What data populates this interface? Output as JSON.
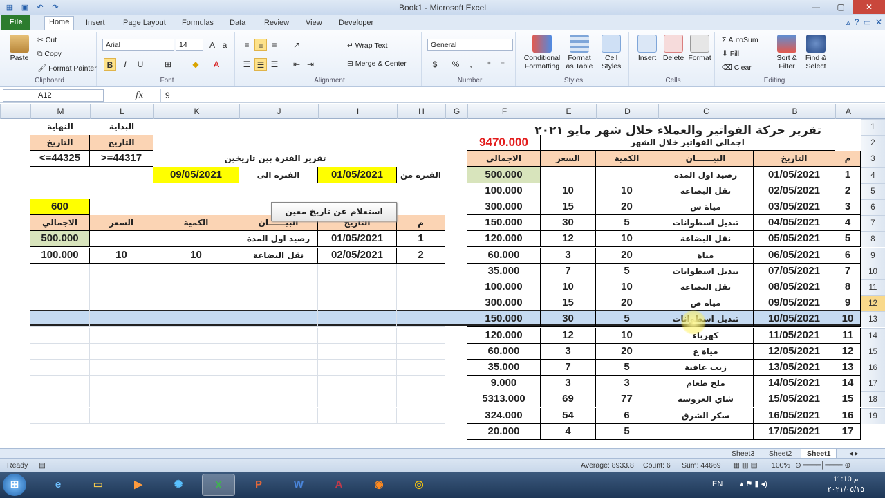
{
  "window": {
    "title": "Book1 - Microsoft Excel"
  },
  "tabs": [
    "File",
    "Home",
    "Insert",
    "Page Layout",
    "Formulas",
    "Data",
    "Review",
    "View",
    "Developer"
  ],
  "ribbon": {
    "clipboard": {
      "paste": "Paste",
      "cut": "Cut",
      "copy": "Copy",
      "format_painter": "Format Painter",
      "group": "Clipboard"
    },
    "font": {
      "family": "Arial",
      "size": "14",
      "bold": "B",
      "italic": "I",
      "underline": "U",
      "group": "Font"
    },
    "alignment": {
      "wrap": "Wrap Text",
      "merge": "Merge & Center",
      "group": "Alignment"
    },
    "number": {
      "format": "General",
      "percent": "%",
      "comma": ",",
      "group": "Number"
    },
    "styles": {
      "conditional": "Conditional Formatting",
      "format_table": "Format as Table",
      "cell_styles": "Cell Styles",
      "group": "Styles"
    },
    "cells": {
      "insert": "Insert",
      "delete": "Delete",
      "format": "Format",
      "group": "Cells"
    },
    "editing": {
      "autosum": "AutoSum",
      "fill": "Fill",
      "clear": "Clear",
      "sort": "Sort & Filter",
      "find": "Find & Select",
      "group": "Editing"
    }
  },
  "formula_bar": {
    "name_box": "A12",
    "fx": "fx",
    "value": "9"
  },
  "columns": [
    "M",
    "L",
    "K",
    "J",
    "I",
    "H",
    "G",
    "F",
    "E",
    "D",
    "C",
    "B",
    "A"
  ],
  "rows": [
    "1",
    "2",
    "3",
    "4",
    "5",
    "6",
    "7",
    "8",
    "9",
    "10",
    "11",
    "12",
    "13",
    "14",
    "15",
    "16",
    "17",
    "18",
    "19"
  ],
  "sheet": {
    "title": "تقرير حركة الفواتير والعملاء خلال شهر مايو ٢٠٢١",
    "total_label": "اجمالي الفواتير خلال الشهر",
    "total_value": "9470.000",
    "headers": {
      "no": "م",
      "date": "التاريخ",
      "desc": "البيــــــان",
      "qty": "الكمية",
      "price": "السعر",
      "total": "الاجمالي"
    },
    "rows": [
      {
        "no": "1",
        "date": "01/05/2021",
        "desc": "رصيد اول المدة",
        "qty": "",
        "price": "",
        "total": "500.000"
      },
      {
        "no": "2",
        "date": "02/05/2021",
        "desc": "نقل البضاعة",
        "qty": "10",
        "price": "10",
        "total": "100.000"
      },
      {
        "no": "3",
        "date": "03/05/2021",
        "desc": "مياة س",
        "qty": "20",
        "price": "15",
        "total": "300.000"
      },
      {
        "no": "4",
        "date": "04/05/2021",
        "desc": "تبديل اسطوانات",
        "qty": "5",
        "price": "30",
        "total": "150.000"
      },
      {
        "no": "5",
        "date": "05/05/2021",
        "desc": "نقل البضاعة",
        "qty": "10",
        "price": "12",
        "total": "120.000"
      },
      {
        "no": "6",
        "date": "06/05/2021",
        "desc": "مياة",
        "qty": "20",
        "price": "3",
        "total": "60.000"
      },
      {
        "no": "7",
        "date": "07/05/2021",
        "desc": "تبديل اسطوانات",
        "qty": "5",
        "price": "7",
        "total": "35.000"
      },
      {
        "no": "8",
        "date": "08/05/2021",
        "desc": "نقل البضاعة",
        "qty": "10",
        "price": "10",
        "total": "100.000"
      },
      {
        "no": "9",
        "date": "09/05/2021",
        "desc": "مياة ص",
        "qty": "20",
        "price": "15",
        "total": "300.000"
      },
      {
        "no": "10",
        "date": "10/05/2021",
        "desc": "تبديل اسطوانات",
        "qty": "5",
        "price": "30",
        "total": "150.000"
      },
      {
        "no": "11",
        "date": "11/05/2021",
        "desc": "كهرباء",
        "qty": "10",
        "price": "12",
        "total": "120.000"
      },
      {
        "no": "12",
        "date": "12/05/2021",
        "desc": "مياة ع",
        "qty": "20",
        "price": "3",
        "total": "60.000"
      },
      {
        "no": "13",
        "date": "13/05/2021",
        "desc": "زيت عافية",
        "qty": "5",
        "price": "7",
        "total": "35.000"
      },
      {
        "no": "14",
        "date": "14/05/2021",
        "desc": "ملح طعام",
        "qty": "3",
        "price": "3",
        "total": "9.000"
      },
      {
        "no": "15",
        "date": "15/05/2021",
        "desc": "شاي العروسة",
        "qty": "77",
        "price": "69",
        "total": "5313.000"
      },
      {
        "no": "16",
        "date": "16/05/2021",
        "desc": "سكر الشرق",
        "qty": "6",
        "price": "54",
        "total": "324.000"
      },
      {
        "no": "17",
        "date": "17/05/2021",
        "desc": "",
        "qty": "5",
        "price": "4",
        "total": "20.000"
      }
    ],
    "report": {
      "start_label": "البداية",
      "end_label": "النهاية",
      "date_hdr": "التاريخ",
      "crit_start": ">=44317",
      "crit_end": "<=44325",
      "heading": "تقرير الفترة بين تاريخين",
      "from_label": "الفترة من",
      "from_value": "01/05/2021",
      "to_label": "الفترة الى",
      "to_value": "09/05/2021",
      "button": "استعلام عن تاريخ معين",
      "sum": "600",
      "rows": [
        {
          "no": "1",
          "date": "01/05/2021",
          "desc": "رصيد اول المدة",
          "qty": "",
          "price": "",
          "total": "500.000"
        },
        {
          "no": "2",
          "date": "02/05/2021",
          "desc": "نقل البضاعة",
          "qty": "10",
          "price": "10",
          "total": "100.000"
        }
      ]
    }
  },
  "sheet_tabs": [
    "Sheet3",
    "Sheet2",
    "Sheet1"
  ],
  "status": {
    "ready": "Ready",
    "average": "Average: 8933.8",
    "count": "Count: 6",
    "sum": "Sum: 44669",
    "zoom": "100%"
  },
  "taskbar": {
    "lang": "EN",
    "time": "11:10 م",
    "date": "٢٠٢١/٠٥/١٥"
  }
}
